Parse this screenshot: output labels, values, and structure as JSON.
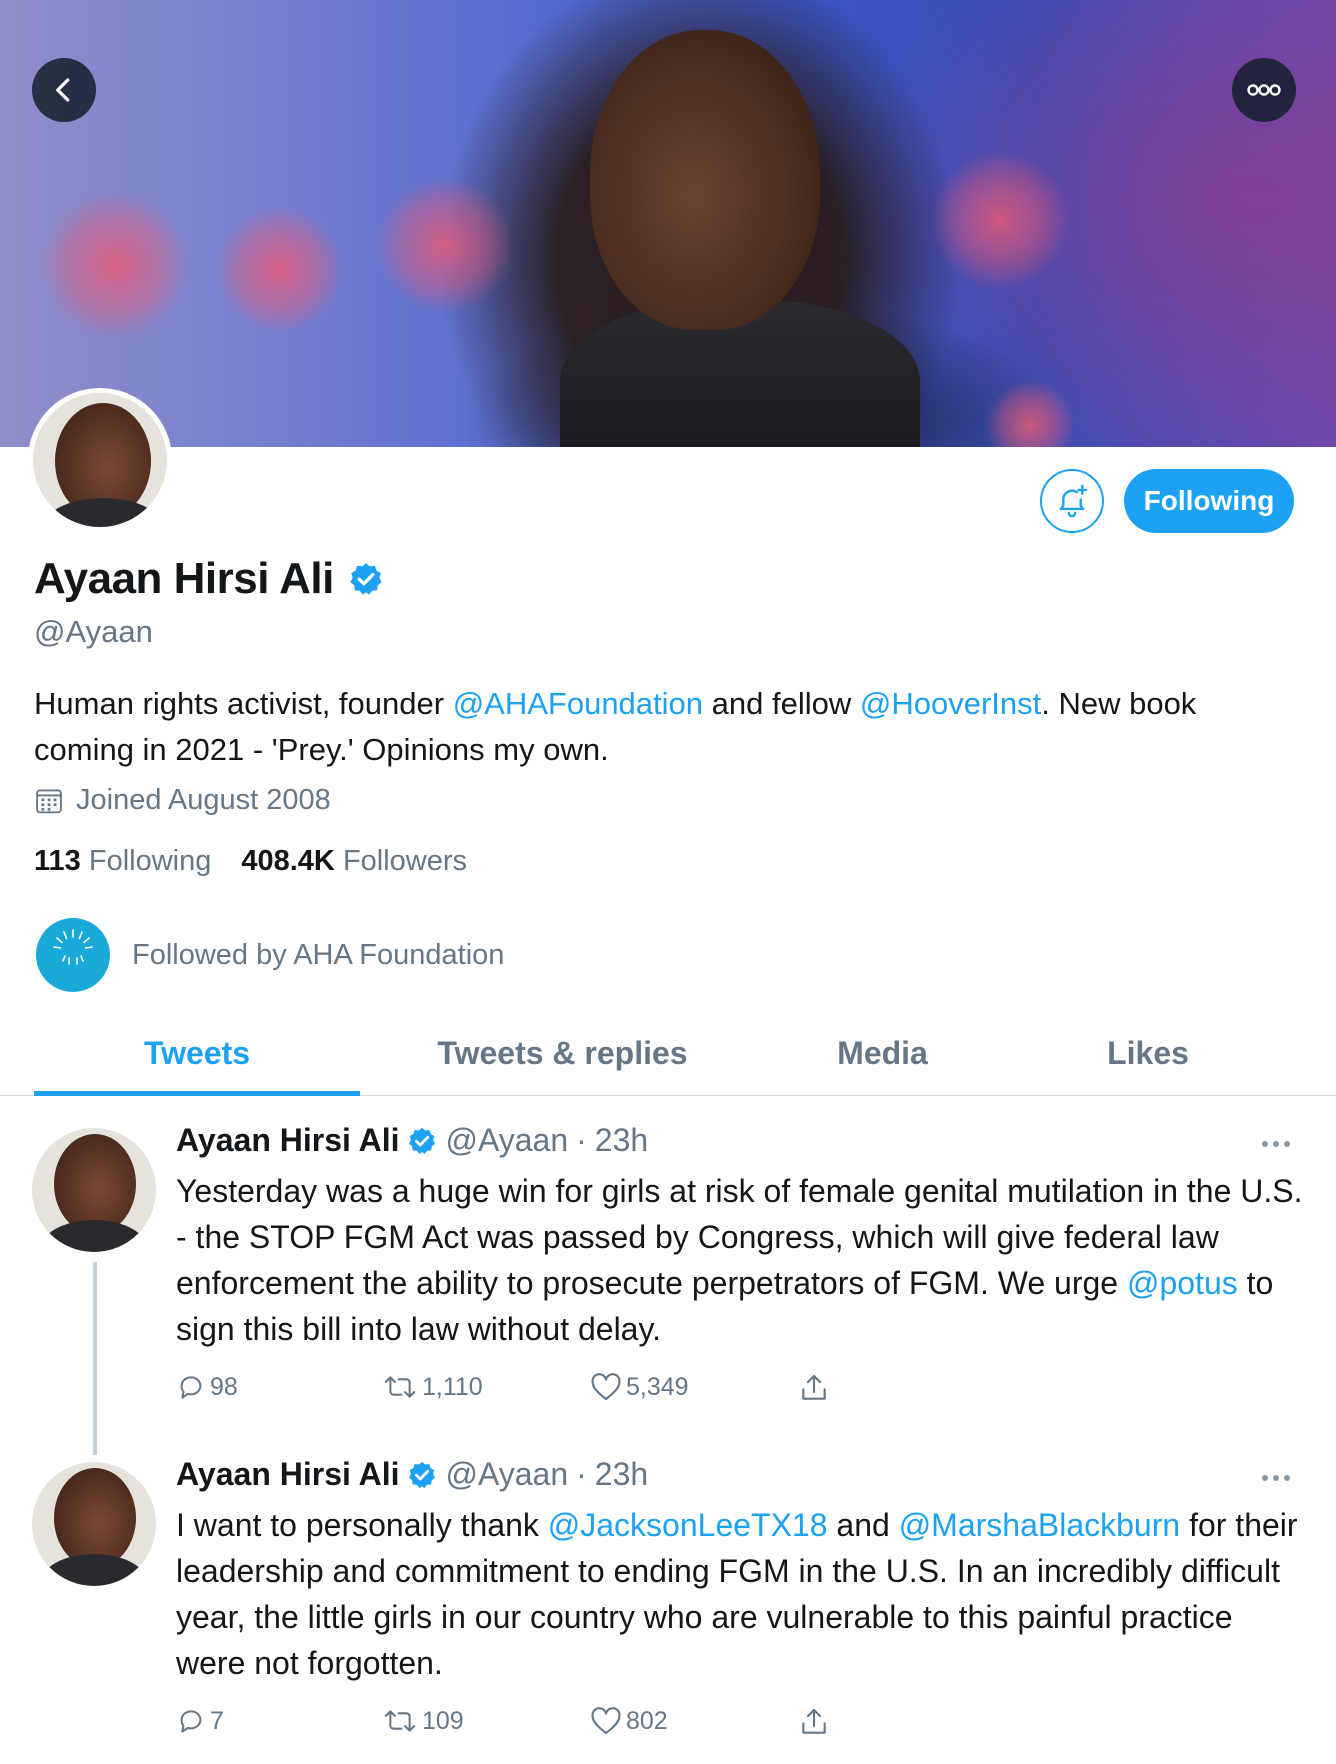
{
  "header": {
    "back_icon": "chevron-left-icon",
    "more_icon": "more-horizontal-icon"
  },
  "profile": {
    "name": "Ayaan Hirsi Ali",
    "handle": "@Ayaan",
    "verified": true,
    "bio": {
      "part1": "Human rights activist, founder ",
      "mention1": "@AHAFoundation",
      "part2": " and fellow ",
      "mention2": "@HooverInst",
      "part3": ". New book coming in 2021 - 'Prey.' Opinions my own."
    },
    "joined": "Joined August 2008",
    "following_count": "113",
    "following_label": "Following",
    "followers_count": "408.4K",
    "followers_label": "Followers",
    "followed_by": "Followed by AHA Foundation",
    "follow_button_label": "Following",
    "accent_color": "#1da1f2"
  },
  "tabs": [
    {
      "label": "Tweets",
      "active": true
    },
    {
      "label": "Tweets & replies",
      "active": false
    },
    {
      "label": "Media",
      "active": false
    },
    {
      "label": "Likes",
      "active": false
    }
  ],
  "tweets": [
    {
      "name": "Ayaan Hirsi Ali",
      "handle": "@Ayaan",
      "separator": "·",
      "time": "23h",
      "text_part1": "Yesterday was a huge win for girls at risk of female genital mutilation in the U.S. - the STOP FGM Act was passed by Congress, which will give federal law enforcement the ability to prosecute perpetrators of FGM. We urge ",
      "mention1": "@potus",
      "text_part2": " to sign this bill into law without delay.",
      "replies": "98",
      "retweets": "1,110",
      "likes": "5,349"
    },
    {
      "name": "Ayaan Hirsi Ali",
      "handle": "@Ayaan",
      "separator": "·",
      "time": "23h",
      "text_part1": "I want to personally thank ",
      "mention1": "@JacksonLeeTX18",
      "text_part2": " and ",
      "mention2": "@MarshaBlackburn",
      "text_part3": " for their leadership and commitment to ending FGM in the U.S. In an incredibly difficult year, the little girls in our country who are vulnerable to this painful practice were not forgotten.",
      "replies": "7",
      "retweets": "109",
      "likes": "802"
    }
  ]
}
